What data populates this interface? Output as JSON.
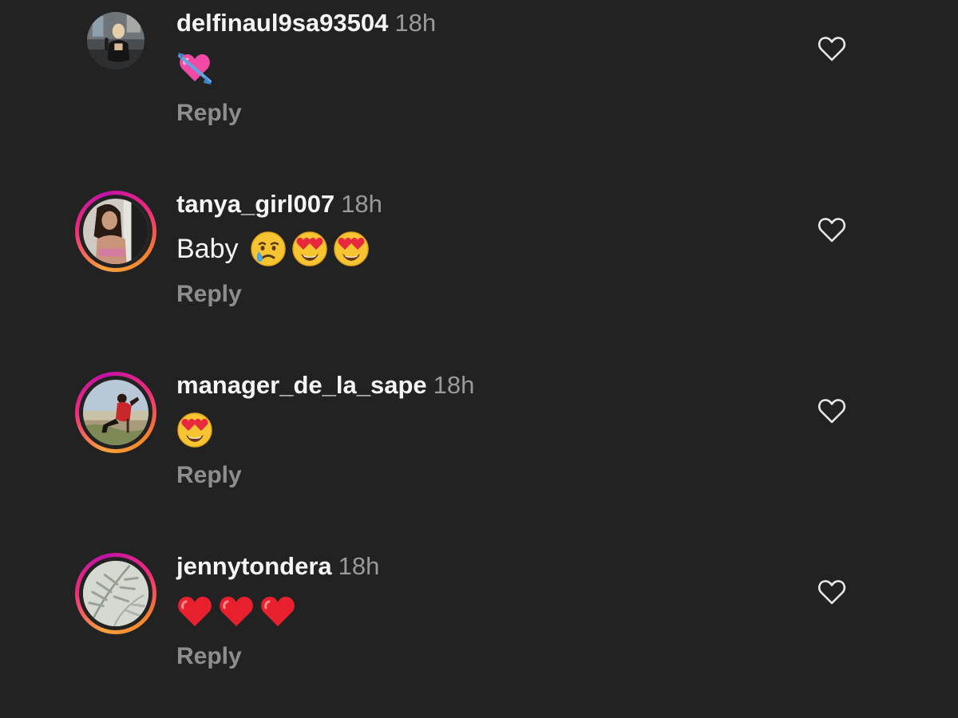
{
  "comments": [
    {
      "username": "delfinaul9sa93504",
      "time": "18h",
      "text": "",
      "emojis": [
        "heart-with-arrow"
      ],
      "reply": "Reply",
      "story_ring": false
    },
    {
      "username": "tanya_girl007",
      "time": "18h",
      "text": "Baby",
      "emojis": [
        "crying-face",
        "heart-eyes",
        "heart-eyes"
      ],
      "reply": "Reply",
      "story_ring": true
    },
    {
      "username": "manager_de_la_sape",
      "time": "18h",
      "text": "",
      "emojis": [
        "heart-eyes"
      ],
      "reply": "Reply",
      "story_ring": true
    },
    {
      "username": "jennytondera",
      "time": "18h",
      "text": "",
      "emojis": [
        "red-heart",
        "red-heart",
        "red-heart"
      ],
      "reply": "Reply",
      "story_ring": true
    }
  ],
  "colors": {
    "background": "#222222",
    "username": "#f5f5f5",
    "timestamp": "#9a9a9a",
    "reply": "#8e8e8e",
    "ring_start": "#f9a03f",
    "ring_end": "#c013a8"
  }
}
